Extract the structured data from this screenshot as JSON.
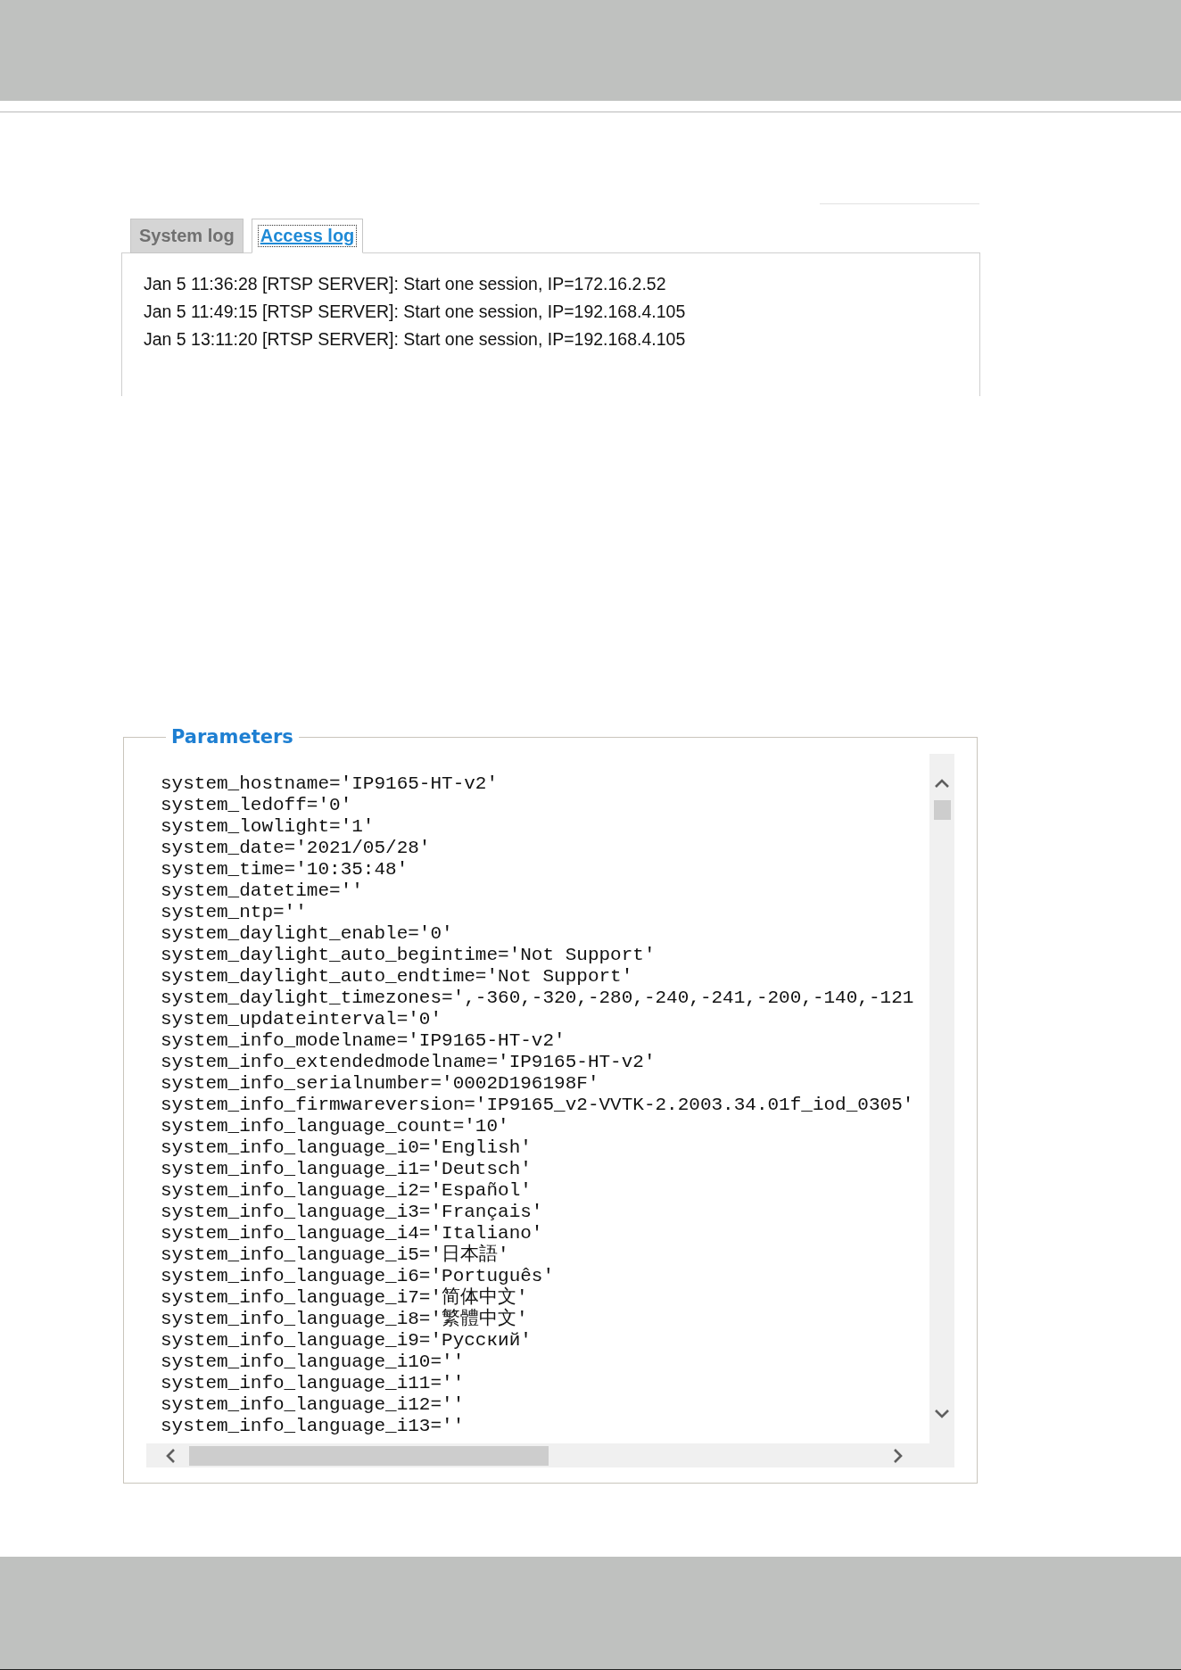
{
  "log_tabs": [
    {
      "label": "System log",
      "selected": false
    },
    {
      "label": "Access log",
      "selected": true
    }
  ],
  "log_entries": [
    "Jan 5 11:36:28 [RTSP SERVER]: Start one session, IP=172.16.2.52",
    "Jan 5 11:49:15 [RTSP SERVER]: Start one session, IP=192.168.4.105",
    "Jan 5 13:11:20 [RTSP SERVER]: Start one session, IP=192.168.4.105"
  ],
  "parameters": {
    "title": "Parameters",
    "lines": [
      "system_hostname='IP9165-HT-v2'",
      "system_ledoff='0'",
      "system_lowlight='1'",
      "system_date='2021/05/28'",
      "system_time='10:35:48'",
      "system_datetime=''",
      "system_ntp=''",
      "system_daylight_enable='0'",
      "system_daylight_auto_begintime='Not Support'",
      "system_daylight_auto_endtime='Not Support'",
      "system_daylight_timezones=',-360,-320,-280,-240,-241,-200,-140,-121",
      "system_updateinterval='0'",
      "system_info_modelname='IP9165-HT-v2'",
      "system_info_extendedmodelname='IP9165-HT-v2'",
      "system_info_serialnumber='0002D196198F'",
      "system_info_firmwareversion='IP9165_v2-VVTK-2.2003.34.01f_iod_0305'",
      "system_info_language_count='10'",
      "system_info_language_i0='English'",
      "system_info_language_i1='Deutsch'",
      "system_info_language_i2='Español'",
      "system_info_language_i3='Français'",
      "system_info_language_i4='Italiano'",
      "system_info_language_i5='日本語'",
      "system_info_language_i6='Português'",
      "system_info_language_i7='简体中文'",
      "system_info_language_i8='繁體中文'",
      "system_info_language_i9='Русский'",
      "system_info_language_i10=''",
      "system_info_language_i11=''",
      "system_info_language_i12=''",
      "system_info_language_i13=''"
    ]
  }
}
